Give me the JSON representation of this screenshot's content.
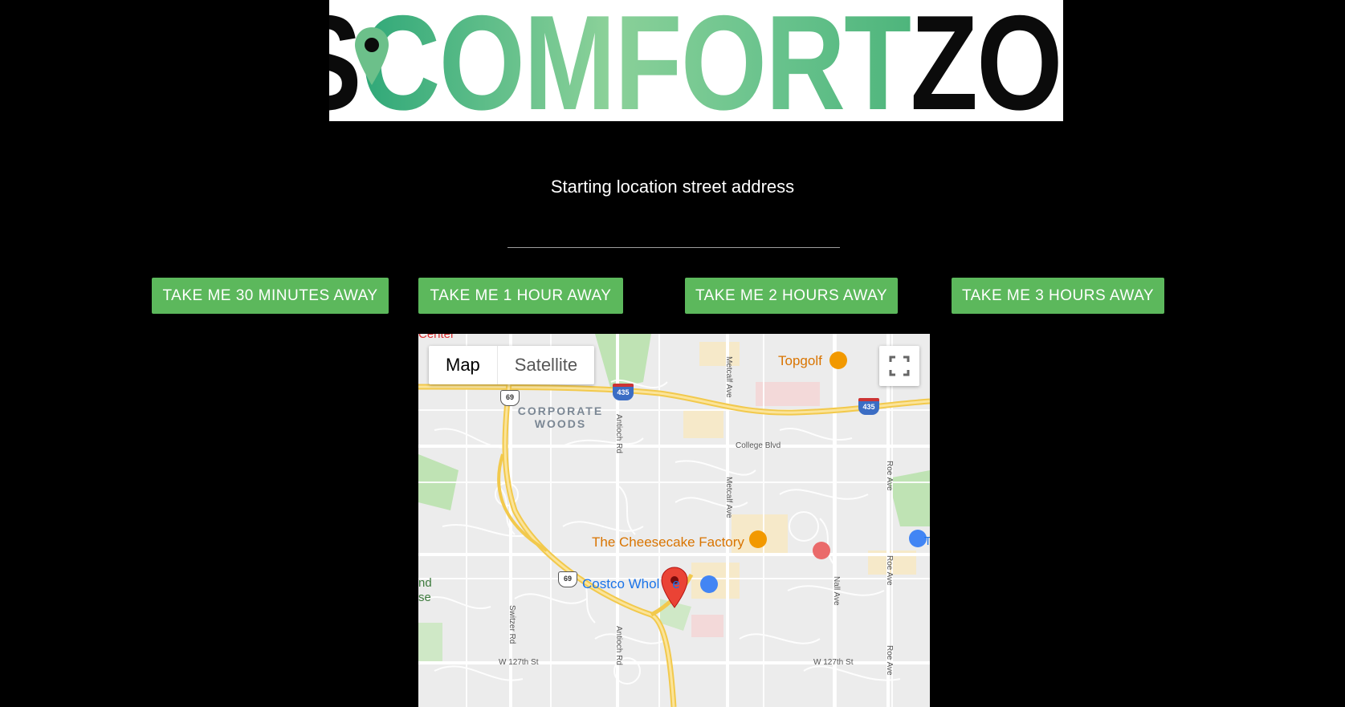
{
  "logo": {
    "part_dis": "DIS",
    "part_comfort": "COMFORT",
    "part_zone": "ZONE",
    "pin_icon": "map-pin-icon",
    "colors": {
      "dark": "#0b0b0b",
      "green": "#6cc08a"
    }
  },
  "form": {
    "prompt": "Starting location street address",
    "address_value": "",
    "address_placeholder": ""
  },
  "buttons": [
    {
      "label": "TAKE ME 30 MINUTES AWAY"
    },
    {
      "label": "TAKE ME 1 HOUR AWAY"
    },
    {
      "label": "TAKE ME 2 HOURS AWAY"
    },
    {
      "label": "TAKE ME 3 HOURS AWAY"
    }
  ],
  "button_color": "#5cb85c",
  "map": {
    "map_type_selected": "Map",
    "map_type_options": [
      "Map",
      "Satellite"
    ],
    "fullscreen_icon": "fullscreen-icon",
    "marker_icon": "red-location-marker-icon",
    "places": {
      "topgolf": "Topgolf",
      "cheesecake": "The Cheesecake Factory",
      "costco": "Costco Whol",
      "costco_suffix": "e",
      "corporate_woods": "CORPORATE WOODS",
      "center": "Center",
      "left_partial_1": "nd",
      "left_partial_2": "se",
      "right_partial": "T"
    },
    "streets": {
      "college": "College Blvd",
      "w127_left": "W 127th St",
      "w127_right": "W 127th St",
      "metcalf_top": "Metcalf Ave",
      "metcalf_mid": "Metcalf Ave",
      "antioch_top": "Antioch Rd",
      "antioch_bottom": "Antioch Rd",
      "switzer": "Switzer Rd",
      "nall": "Nall Ave",
      "roe_top": "Roe Ave",
      "roe_mid": "Roe Ave",
      "roe_bottom": "Roe Ave"
    },
    "shields": {
      "us69_top": "69",
      "us69_bottom": "69",
      "i435_left": "435",
      "i435_right": "435"
    }
  }
}
